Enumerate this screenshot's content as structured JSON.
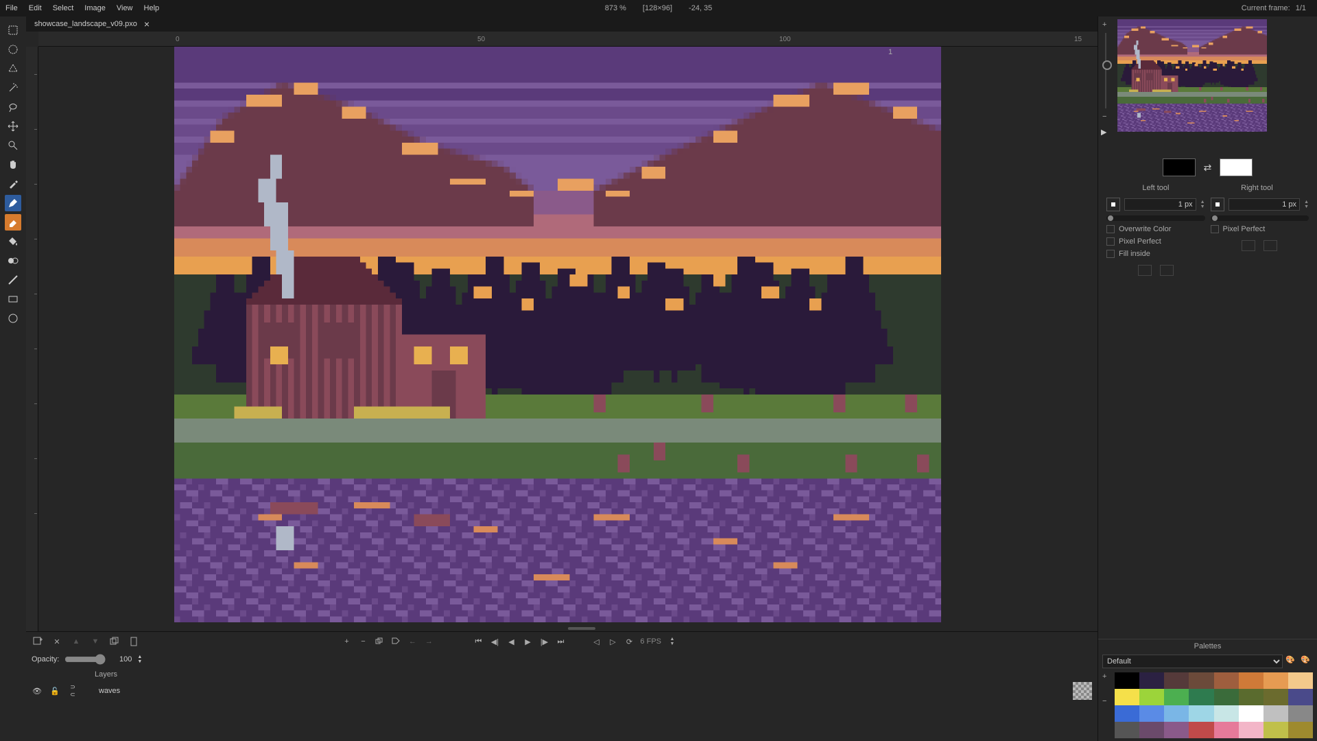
{
  "menu": {
    "file": "File",
    "edit": "Edit",
    "select": "Select",
    "image": "Image",
    "view": "View",
    "help": "Help"
  },
  "status": {
    "zoom": "873 %",
    "dims": "[128×96]",
    "coords": "-24, 35"
  },
  "frame": {
    "label": "Current frame:",
    "value": "1/1"
  },
  "tab": {
    "name": "showcase_landscape_v09.pxo"
  },
  "ruler": {
    "t0": "0",
    "t50": "50",
    "t100": "100",
    "t150": "15"
  },
  "opacity": {
    "label": "Opacity:",
    "value": "100"
  },
  "layers": {
    "header": "Layers",
    "frame_num": "1",
    "layer1_name": "waves"
  },
  "left_tool": {
    "label": "Left tool",
    "size": "1 px",
    "overwrite": "Overwrite Color",
    "pixel_perfect": "Pixel Perfect",
    "fill_inside": "Fill inside"
  },
  "right_tool": {
    "label": "Right tool",
    "size": "1 px",
    "pixel_perfect": "Pixel Perfect"
  },
  "colors": {
    "left": "#000000",
    "right": "#ffffff"
  },
  "palettes": {
    "title": "Palettes",
    "selected": "Default"
  },
  "fps": {
    "label": "6 FPS"
  },
  "palette_colors": [
    "#000000",
    "#2b2142",
    "#553a3a",
    "#6b4a3a",
    "#9e5e3e",
    "#cf7a38",
    "#e69b52",
    "#f3c98b",
    "#f5e04a",
    "#9cd43a",
    "#4caf50",
    "#2e7b4f",
    "#3a6b3a",
    "#5a6b2e",
    "#6b6b2e",
    "#4a4a8a",
    "#3a6bd6",
    "#5a8be6",
    "#7ab6e6",
    "#9ed6e6",
    "#c8e6e6",
    "#ffffff",
    "#c0c0c0",
    "#888888",
    "#555555",
    "#6b4a6b",
    "#8a5a8a",
    "#c04a4a",
    "#e67a9a",
    "#f3b6c8",
    "#c0c04a",
    "#9e8a2e"
  ]
}
